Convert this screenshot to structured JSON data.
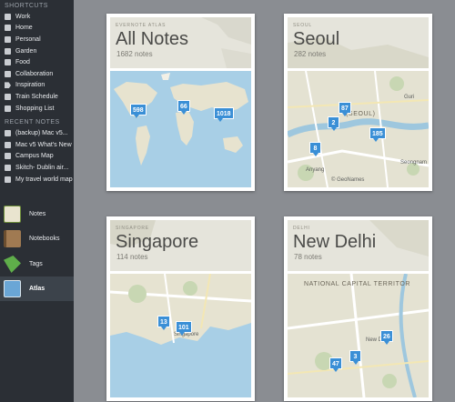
{
  "sidebar": {
    "shortcuts_title": "SHORTCUTS",
    "shortcuts": [
      {
        "label": "Work",
        "icon": "note-icon"
      },
      {
        "label": "Home",
        "icon": "note-icon"
      },
      {
        "label": "Personal",
        "icon": "note-icon"
      },
      {
        "label": "Garden",
        "icon": "note-icon"
      },
      {
        "label": "Food",
        "icon": "note-icon"
      },
      {
        "label": "Collaboration",
        "icon": "note-icon"
      },
      {
        "label": "Inspiration",
        "icon": "tag-icon"
      },
      {
        "label": "Train Schedule",
        "icon": "note-icon"
      },
      {
        "label": "Shopping List",
        "icon": "note-icon"
      }
    ],
    "recent_title": "RECENT NOTES",
    "recent": [
      {
        "label": "(backup) Mac v5..."
      },
      {
        "label": "Mac v5 What's New"
      },
      {
        "label": "Campus Map"
      },
      {
        "label": "Skitch- Dublin air..."
      },
      {
        "label": "My travel world map"
      }
    ],
    "nav": [
      {
        "label": "Notes",
        "icon": "notes-icon",
        "selected": false
      },
      {
        "label": "Notebooks",
        "icon": "notebooks-icon",
        "selected": false
      },
      {
        "label": "Tags",
        "icon": "tags-icon",
        "selected": false
      },
      {
        "label": "Atlas",
        "icon": "atlas-icon",
        "selected": true
      }
    ]
  },
  "cards": [
    {
      "eyebrow": "EVERNOTE ATLAS",
      "title": "All Notes",
      "count": "1682 notes",
      "pins": [
        "598",
        "66",
        "1018"
      ],
      "labels": []
    },
    {
      "eyebrow": "SEOUL",
      "title": "Seoul",
      "count": "282 notes",
      "pins": [
        "87",
        "2",
        "185",
        "8"
      ],
      "labels": [
        "(SEOUL)",
        "Guri",
        "Seongnam",
        "Anyang",
        "© GeoNames"
      ]
    },
    {
      "eyebrow": "SINGAPORE",
      "title": "Singapore",
      "count": "114 notes",
      "pins": [
        "13",
        "101"
      ],
      "labels": [
        "Singapore"
      ]
    },
    {
      "eyebrow": "DELHI",
      "title": "New Delhi",
      "count": "78 notes",
      "pins": [
        "26",
        "3",
        "47"
      ],
      "labels": [
        "NATIONAL CAPITAL TERRITOR",
        "New Delhi"
      ]
    }
  ],
  "colors": {
    "pin": "#3a8fd6",
    "sidebar": "#2b2f35",
    "background": "#8a8d92",
    "water": "#a8cfe6",
    "land": "#e8e6d6"
  }
}
